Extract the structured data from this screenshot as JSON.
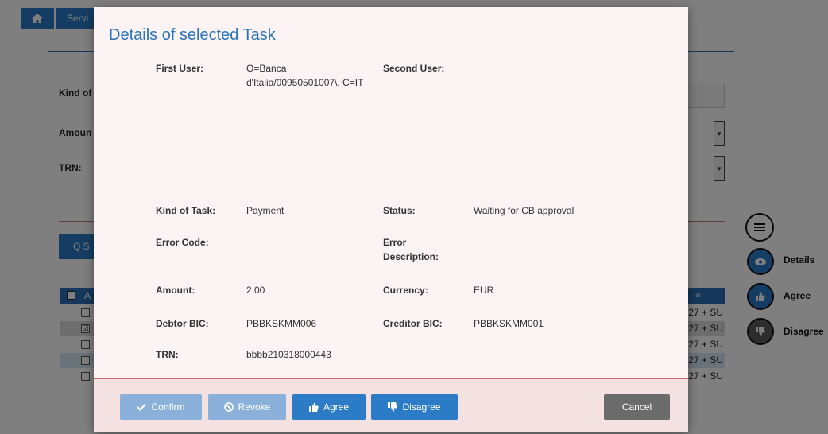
{
  "background": {
    "breadcrumb": {
      "item": "Servi"
    },
    "filters": {
      "kind_label": "Kind of",
      "amount_label": "Amoun",
      "trn_label": "TRN:"
    },
    "search_button_label": "Q S",
    "table": {
      "header_first": "A",
      "row_tail_text": "27 + SU",
      "rows": [
        {
          "checked": false,
          "tail": "27 + SU"
        },
        {
          "checked": true,
          "tail": "27 + SU"
        },
        {
          "checked": false,
          "tail": "27 + SU"
        },
        {
          "checked": false,
          "tail": "27 + SU"
        },
        {
          "checked": false,
          "tail": "27 + SU"
        }
      ]
    },
    "side_actions": {
      "details": "Details",
      "agree": "Agree",
      "disagree": "Disagree"
    }
  },
  "modal": {
    "title": "Details of selected Task",
    "fields": {
      "first_user_label": "First User:",
      "first_user_value": "O=Banca d'Italia/00950501007\\, C=IT",
      "second_user_label": "Second User:",
      "second_user_value": "",
      "kind_of_task_label": "Kind of Task:",
      "kind_of_task_value": "Payment",
      "status_label": "Status:",
      "status_value": "Waiting for CB approval",
      "error_code_label": "Error Code:",
      "error_code_value": "",
      "error_description_label": "Error Description:",
      "error_description_value": "",
      "amount_label": "Amount:",
      "amount_value": "2.00",
      "currency_label": "Currency:",
      "currency_value": "EUR",
      "debtor_bic_label": "Debtor BIC:",
      "debtor_bic_value": "PBBKSKMM006",
      "creditor_bic_label": "Creditor BIC:",
      "creditor_bic_value": "PBBKSKMM001",
      "trn_label": "TRN:",
      "trn_value": "bbbb210318000443"
    },
    "buttons": {
      "confirm": "Confirm",
      "revoke": "Revoke",
      "agree": "Agree",
      "disagree": "Disagree",
      "cancel": "Cancel"
    }
  },
  "colors": {
    "primary": "#2b7bc7",
    "primary_disabled": "#8bb1da",
    "title": "#2b73bd",
    "modal_bg": "#fbf3f4",
    "footer_bg": "#f4e2e3",
    "footer_border": "#d46868",
    "cancel": "#6b6b6b"
  }
}
